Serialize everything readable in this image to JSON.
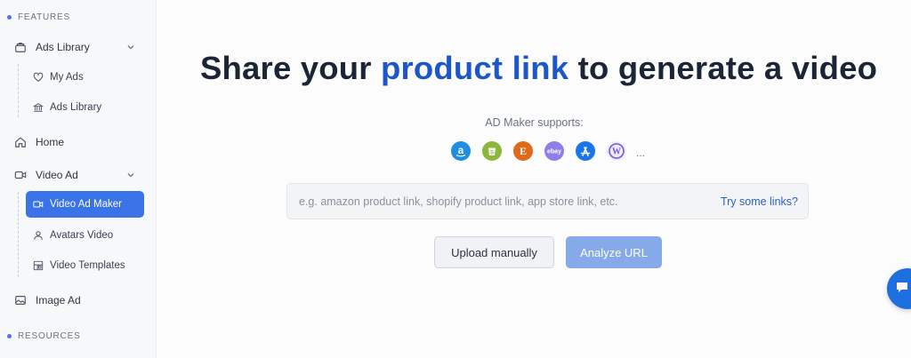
{
  "sidebar": {
    "features_label": "FEATURES",
    "resources_label": "RESOURCES",
    "items": {
      "ads_library": "Ads Library",
      "my_ads": "My Ads",
      "ads_library_sub": "Ads Library",
      "home": "Home",
      "video_ad": "Video Ad",
      "video_ad_maker": "Video Ad Maker",
      "avatars_video": "Avatars Video",
      "video_templates": "Video Templates",
      "image_ad": "Image Ad"
    },
    "active_item": "Video Ad Maker",
    "accent_color": "#3a73e8"
  },
  "main": {
    "headline_pre": "Share your ",
    "headline_highlight": "product link",
    "headline_post": " to generate a video",
    "supports_label": "AD Maker supports:",
    "platforms": [
      "amazon-icon",
      "shopify-icon",
      "etsy-icon",
      "ebay-icon",
      "app-store-icon",
      "wordpress-icon"
    ],
    "platforms_more": "...",
    "url_placeholder": "e.g. amazon product link, shopify product link, app store link, etc.",
    "url_value": "",
    "try_links": "Try some links?",
    "upload_button": "Upload manually",
    "analyze_button": "Analyze URL",
    "highlight_color": "#1d56c9"
  }
}
